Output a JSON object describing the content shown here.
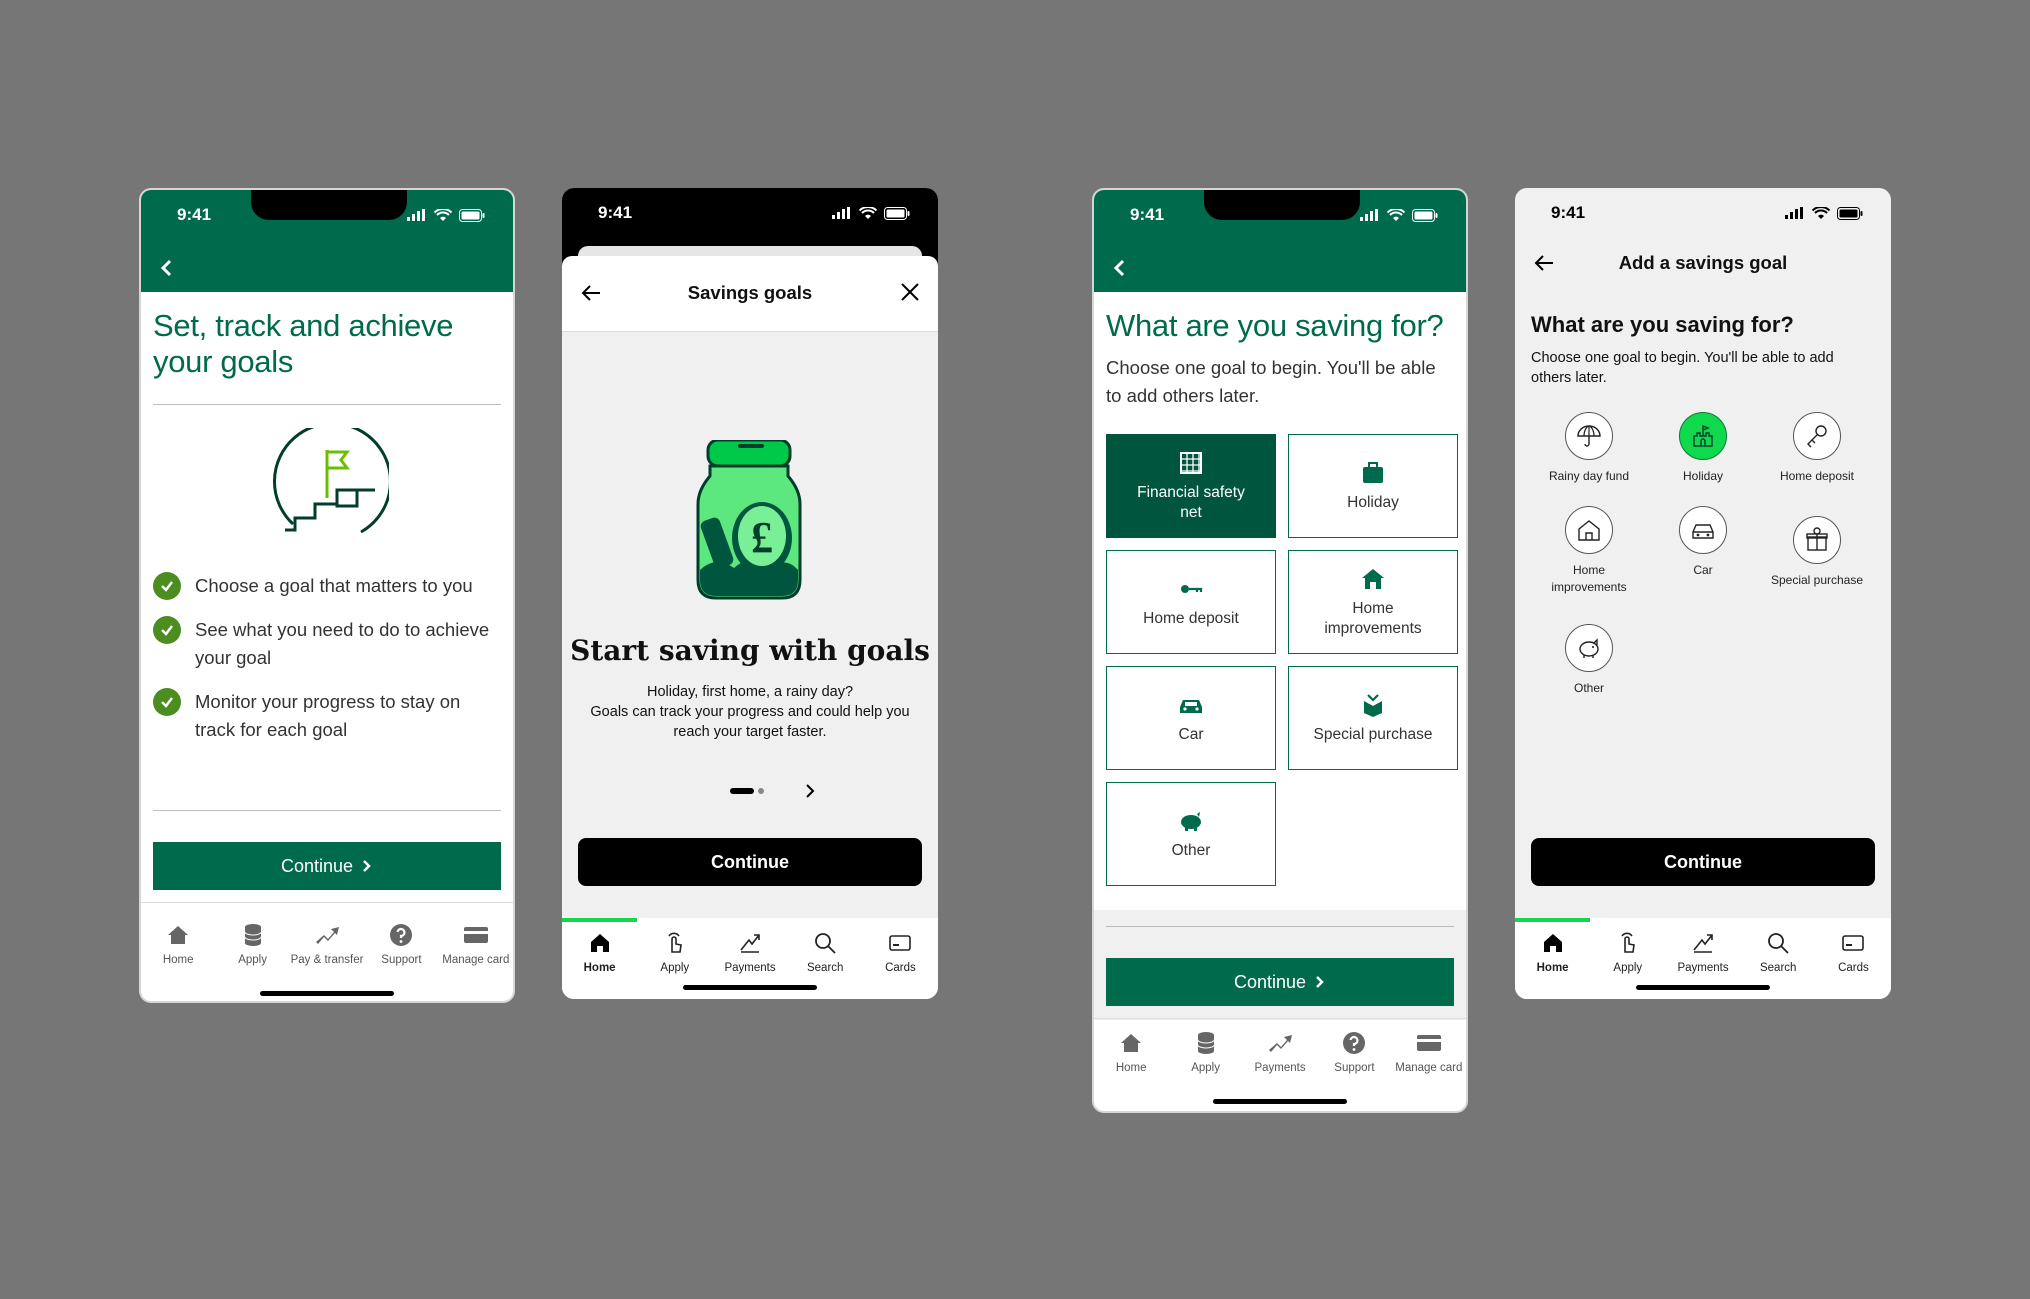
{
  "status": {
    "time": "9:41"
  },
  "screen1": {
    "title": "Set, track and achieve your goals",
    "checks": [
      "Choose a goal that matters to you",
      "See what you need to do to achieve your goal",
      "Monitor your progress to stay on track for each goal"
    ],
    "continue_label": "Continue",
    "nav": [
      "Home",
      "Apply",
      "Pay & transfer",
      "Support",
      "Manage card"
    ]
  },
  "screen2": {
    "header_title": "Savings goals",
    "headline": "Start saving with goals",
    "body_line1": "Holiday, first home, a rainy day?",
    "body_line2": "Goals can track your progress and could help you reach your target faster.",
    "continue_label": "Continue",
    "nav": [
      "Home",
      "Apply",
      "Payments",
      "Search",
      "Cards"
    ]
  },
  "screen3": {
    "title": "What are you saving for?",
    "subtitle": "Choose one goal to begin. You'll be able to add others later.",
    "tiles": [
      "Financial safety net",
      "Holiday",
      "Home deposit",
      "Home improvements",
      "Car",
      "Special purchase",
      "Other"
    ],
    "continue_label": "Continue",
    "nav": [
      "Home",
      "Apply",
      "Payments",
      "Support",
      "Manage card"
    ]
  },
  "screen4": {
    "header_title": "Add a savings goal",
    "title": "What are you saving for?",
    "subtitle": "Choose one goal to begin. You'll be able to add others later.",
    "goals": [
      "Rainy day fund",
      "Holiday",
      "Home deposit",
      "Home improvements",
      "Car",
      "Special purchase",
      "Other"
    ],
    "continue_label": "Continue",
    "nav": [
      "Home",
      "Apply",
      "Payments",
      "Search",
      "Cards"
    ]
  },
  "colors": {
    "brand_green": "#006a4d",
    "dark_green": "#00553e",
    "accent_green": "#11d94e",
    "check_green": "#4b8d1f"
  }
}
